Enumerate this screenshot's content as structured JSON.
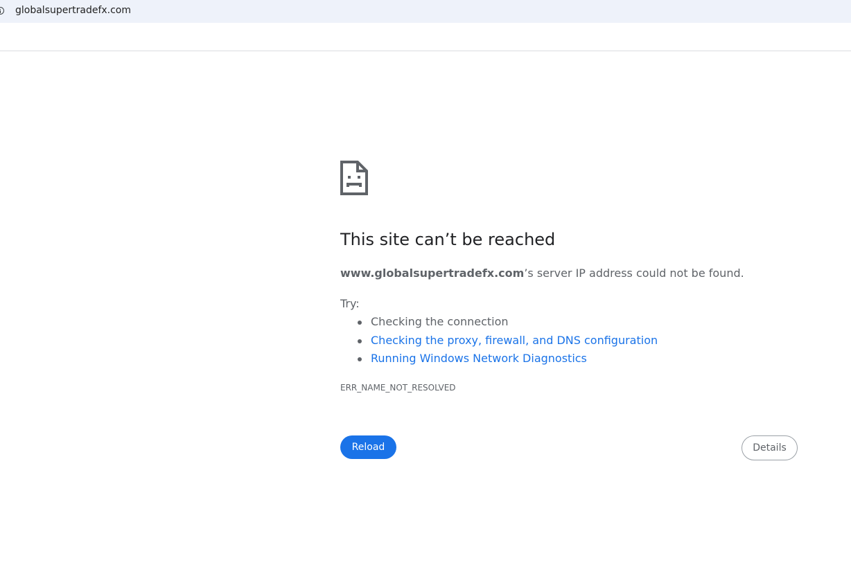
{
  "browser": {
    "url": "globalsupertradefx.com",
    "info_icon": "info-icon"
  },
  "error_page": {
    "icon": "sad-file-icon",
    "title": "This site can’t be reached",
    "summary_domain": "www.globalsupertradefx.com",
    "summary_rest": "’s server IP address could not be found.",
    "try_label": "Try:",
    "suggestions": [
      {
        "label": "Checking the connection",
        "is_link": false
      },
      {
        "label": "Checking the proxy, firewall, and DNS configuration",
        "is_link": true
      },
      {
        "label": "Running Windows Network Diagnostics",
        "is_link": true
      }
    ],
    "error_code": "ERR_NAME_NOT_RESOLVED",
    "reload_label": "Reload",
    "details_label": "Details"
  },
  "colors": {
    "accent": "#1a73e8",
    "text_secondary": "#5f6368",
    "address_bar_bg": "#eef2fa"
  }
}
